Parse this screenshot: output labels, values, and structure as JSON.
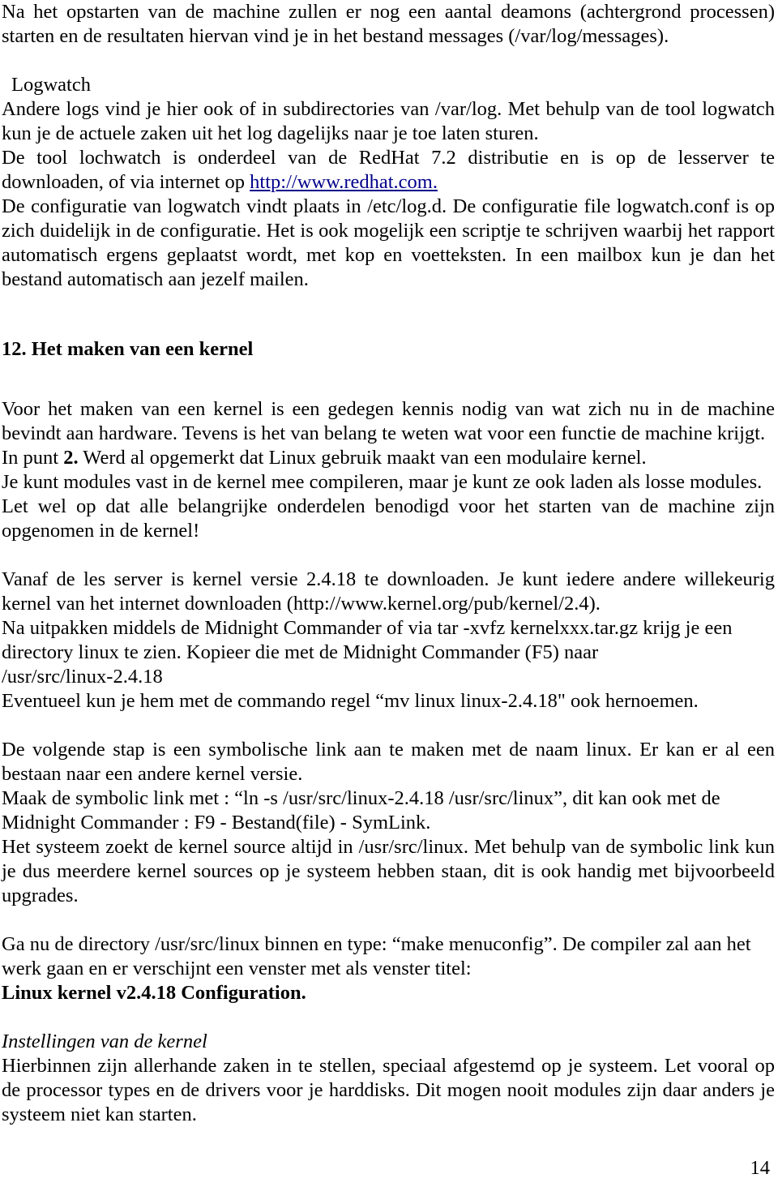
{
  "document": {
    "language": "nl",
    "page_number": "14",
    "link_color": "#00008b",
    "text_color": "#000000",
    "background_color": "#ffffff"
  },
  "content": {
    "intro_paragraph": "Na het opstarten van de machine zullen er nog een aantal deamons (achtergrond processen) starten en de resultaten hiervan vind je in het bestand messages (/var/log/messages).",
    "logwatch_heading": "Logwatch",
    "logwatch_p1": "Andere logs vind je hier ook of in subdirectories van /var/log. Met behulp van de tool logwatch kun je de actuele zaken uit het log dagelijks naar je toe laten sturen.",
    "logwatch_p2_before_link": "De tool lochwatch is onderdeel van de RedHat 7.2 distributie en is op de lesserver te downloaden, of via internet op ",
    "logwatch_link_text": "http://www.redhat.com.",
    "logwatch_p3": "De configuratie van logwatch vindt plaats in /etc/log.d. De configuratie file logwatch.conf is op zich duidelijk in de configuratie. Het is ook mogelijk een scriptje te schrijven waarbij het rapport automatisch ergens geplaatst wordt, met kop en voetteksten. In een mailbox kun je dan het bestand automatisch aan jezelf mailen.",
    "section_12_heading": "12. Het maken van een kernel",
    "kernel_p1": "Voor het maken van een kernel is een gedegen kennis nodig van wat zich nu in de machine bevindt aan hardware. Tevens is het van belang te weten wat voor een functie de machine krijgt.",
    "kernel_p2_a": "In punt ",
    "kernel_p2_bold": "2.",
    "kernel_p2_b": " Werd al opgemerkt dat Linux gebruik maakt van een modulaire kernel.",
    "kernel_p3": "Je kunt modules vast in de kernel mee compileren, maar je kunt ze ook laden als losse modules.",
    "kernel_p4": "Let wel op dat alle belangrijke onderdelen benodigd voor het starten van de machine zijn opgenomen in de kernel!",
    "download_p1": "Vanaf de les server is kernel versie 2.4.18 te downloaden. Je kunt iedere andere willekeurig kernel van het internet downloaden (http://www.kernel.org/pub/kernel/2.4).",
    "download_p2": "Na uitpakken middels de Midnight Commander of via tar -xvfz kernelxxx.tar.gz krijg je een directory linux te zien. Kopieer die met de Midnight Commander (F5) naar",
    "download_path": " /usr/src/linux-2.4.18",
    "download_p3": "Eventueel kun je hem met de commando regel “mv linux linux-2.4.18\" ook hernoemen.",
    "symlink_p1": "De volgende stap is een symbolische link aan te maken met de naam linux. Er kan er al een bestaan naar een andere kernel versie.",
    "symlink_p2": "Maak de symbolic link met : “ln -s /usr/src/linux-2.4.18 /usr/src/linux”, dit kan ook met de Midnight Commander : F9 - Bestand(file) - SymLink.",
    "symlink_p3": "Het systeem zoekt de kernel source altijd in /usr/src/linux. Met behulp van de symbolic link kun je dus meerdere kernel sources op je systeem hebben staan, dit is ook handig met bijvoorbeeld upgrades.",
    "menuconfig_p1": "Ga nu de directory /usr/src/linux binnen en type: “make menuconfig”. De compiler zal aan het werk gaan en er verschijnt een venster met als venster titel:",
    "menuconfig_title": " Linux kernel v2.4.18 Configuration.",
    "settings_heading": "Instellingen van de kernel",
    "settings_p1": "Hierbinnen zijn allerhande zaken in te stellen, speciaal afgestemd op je systeem. Let vooral op de processor types en de drivers voor je harddisks. Dit mogen nooit modules zijn daar anders je systeem niet kan starten."
  }
}
